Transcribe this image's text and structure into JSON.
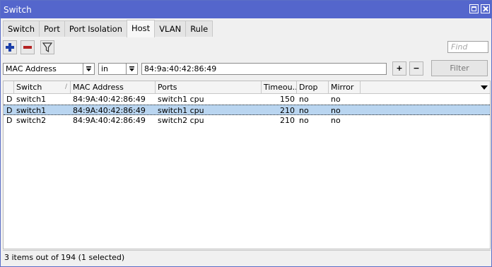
{
  "window": {
    "title": "Switch"
  },
  "tabs": [
    {
      "label": "Switch",
      "active": false
    },
    {
      "label": "Port",
      "active": false
    },
    {
      "label": "Port Isolation",
      "active": false
    },
    {
      "label": "Host",
      "active": true
    },
    {
      "label": "VLAN",
      "active": false
    },
    {
      "label": "Rule",
      "active": false
    }
  ],
  "toolbar": {
    "find_placeholder": "Find",
    "icons": [
      "plus-icon",
      "minus-icon",
      "filter-icon"
    ]
  },
  "filter": {
    "field": "MAC Address",
    "operator": "in",
    "value": "84:9a:40:42:86:49",
    "add_label": "+",
    "remove_label": "−",
    "button_label": "Filter"
  },
  "table": {
    "columns": [
      "Switch",
      "MAC Address",
      "Ports",
      "Timeou...",
      "Drop",
      "Mirror"
    ],
    "rows": [
      {
        "flag": "D",
        "switch": "switch1",
        "mac": "84:9A:40:42:86:49",
        "ports": "switch1 cpu",
        "timeout": "150",
        "drop": "no",
        "mirror": "no",
        "selected": false
      },
      {
        "flag": "D",
        "switch": "switch1",
        "mac": "84:9A:40:42:86:49",
        "ports": "switch1 cpu",
        "timeout": "210",
        "drop": "no",
        "mirror": "no",
        "selected": true
      },
      {
        "flag": "D",
        "switch": "switch2",
        "mac": "84:9A:40:42:86:49",
        "ports": "switch2 cpu",
        "timeout": "210",
        "drop": "no",
        "mirror": "no",
        "selected": false
      }
    ]
  },
  "status": {
    "text": "3 items out of 194 (1 selected)"
  },
  "colors": {
    "titlebar": "#5466cc",
    "selected_row": "#b9d5f0",
    "add_icon": "#1c3fa8",
    "remove_icon": "#b52424"
  }
}
